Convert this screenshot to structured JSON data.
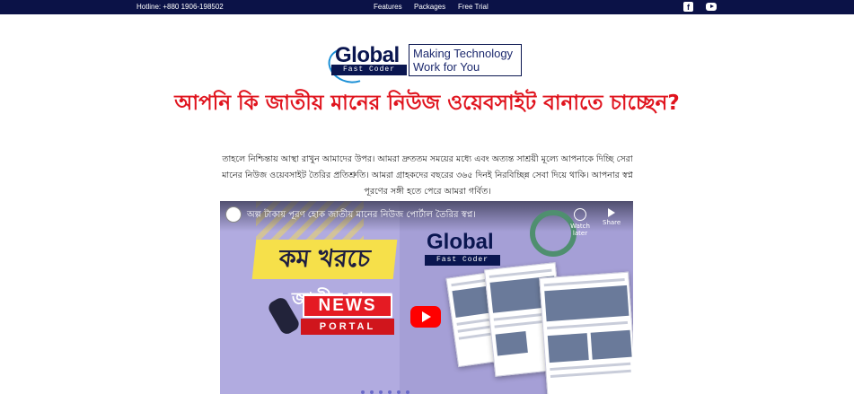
{
  "topbar": {
    "hotline": "Hotline: +880 1906-198502",
    "nav": [
      "Features",
      "Packages",
      "Free Trial"
    ],
    "social": [
      "facebook-icon",
      "youtube-icon"
    ],
    "bg_color": "#0b1247"
  },
  "logo": {
    "mark_text": "Global",
    "mark_subtext": "Fast Coder",
    "tagline_line1": "Making Technology",
    "tagline_line2": "Work for You"
  },
  "hero": {
    "headline": "আপনি কি জাতীয় মানের নিউজ ওয়েবসাইট বানাতে চাচ্ছেন?",
    "description": "তাহলে নিশ্চিন্তায় আস্থা রাখুন আমাদের উপর। আমরা দ্রুততম সময়ের মধ্যে এবং অত্যন্ত সাশ্রয়ী মূল্যে আপনাকে দিচ্ছি সেরা মানের নিউজ ওয়েবসাইট তৈরির প্রতিশ্রুতি। আমরা গ্রাহকদের বছরের ৩৬৫ দিনই নিরবিচ্ছিন্ন সেবা দিয়ে থাকি। আপনার স্বপ্ন পূরণের সঙ্গী হতে পেরে আমরা গর্বিত।",
    "headline_color": "#e0141e"
  },
  "video": {
    "title": "অল্প টাকায় পূরণ হোক জাতীয় মানের নিউজ পোর্টাল তৈরির স্বপ্ন।",
    "watch_later": "Watch later",
    "share": "Share",
    "thumb_text_1": "কম খরচে",
    "thumb_text_2": "জাতীয় মানের",
    "thumb_news": "NEWS",
    "thumb_portal": "PORTAL",
    "thumb_logo": "Global",
    "thumb_logo_sub": "Fast Coder"
  }
}
